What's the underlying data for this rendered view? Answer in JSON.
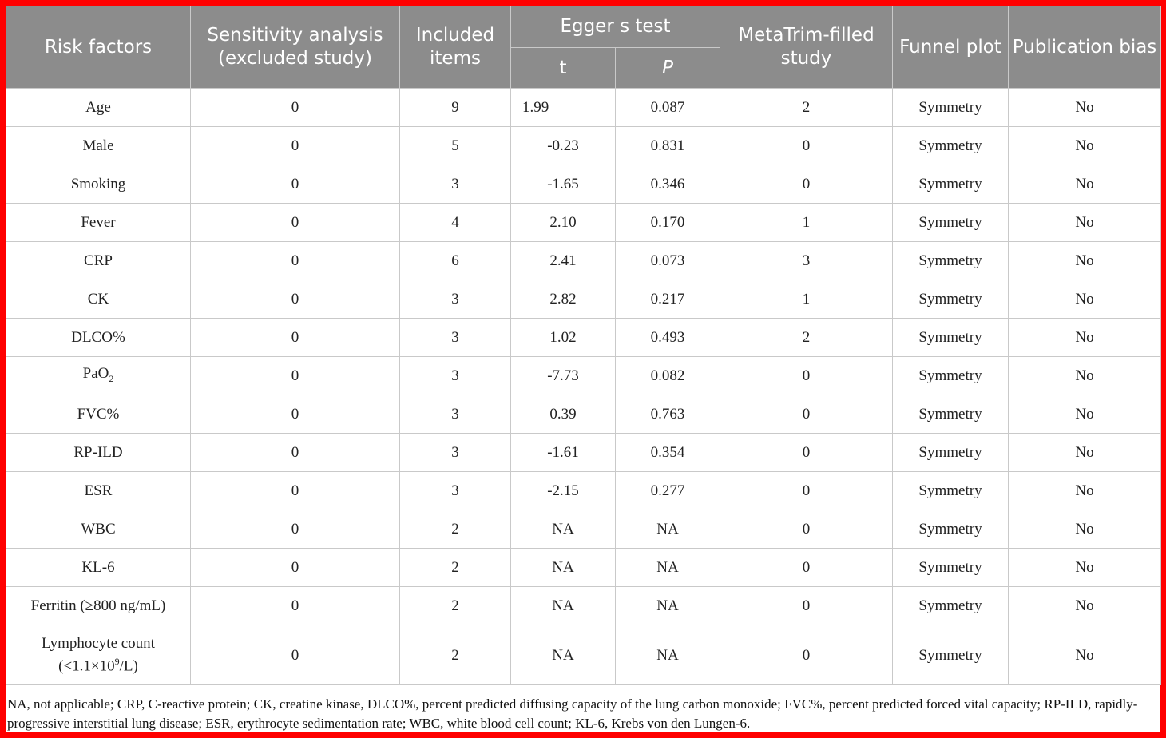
{
  "table": {
    "headers": {
      "risk_factors": "Risk factors",
      "sensitivity": "Sensitivity analysis (excluded study)",
      "included": "Included items",
      "egger": "Egger s test",
      "t": "t",
      "p": "P",
      "metatrim": "MetaTrim-filled study",
      "funnel": "Funnel plot",
      "bias": "Publication bias"
    },
    "rows": [
      {
        "factor": "Age",
        "excluded": "0",
        "included": "9",
        "t": "1.99",
        "p": "0.087",
        "filled": "2",
        "funnel": "Symmetry",
        "bias": "No"
      },
      {
        "factor": "Male",
        "excluded": "0",
        "included": "5",
        "t": "-0.23",
        "p": "0.831",
        "filled": "0",
        "funnel": "Symmetry",
        "bias": "No"
      },
      {
        "factor": "Smoking",
        "excluded": "0",
        "included": "3",
        "t": "-1.65",
        "p": "0.346",
        "filled": "0",
        "funnel": "Symmetry",
        "bias": "No"
      },
      {
        "factor": "Fever",
        "excluded": "0",
        "included": "4",
        "t": "2.10",
        "p": "0.170",
        "filled": "1",
        "funnel": "Symmetry",
        "bias": "No"
      },
      {
        "factor": "CRP",
        "excluded": "0",
        "included": "6",
        "t": "2.41",
        "p": "0.073",
        "filled": "3",
        "funnel": "Symmetry",
        "bias": "No"
      },
      {
        "factor": "CK",
        "excluded": "0",
        "included": "3",
        "t": "2.82",
        "p": "0.217",
        "filled": "1",
        "funnel": "Symmetry",
        "bias": "No"
      },
      {
        "factor": "DLCO%",
        "excluded": "0",
        "included": "3",
        "t": "1.02",
        "p": "0.493",
        "filled": "2",
        "funnel": "Symmetry",
        "bias": "No"
      },
      {
        "factor": "PaO",
        "factor_sub": "2",
        "excluded": "0",
        "included": "3",
        "t": "-7.73",
        "p": "0.082",
        "filled": "0",
        "funnel": "Symmetry",
        "bias": "No"
      },
      {
        "factor": "FVC%",
        "excluded": "0",
        "included": "3",
        "t": "0.39",
        "p": "0.763",
        "filled": "0",
        "funnel": "Symmetry",
        "bias": "No"
      },
      {
        "factor": "RP-ILD",
        "excluded": "0",
        "included": "3",
        "t": "-1.61",
        "p": "0.354",
        "filled": "0",
        "funnel": "Symmetry",
        "bias": "No"
      },
      {
        "factor": "ESR",
        "excluded": "0",
        "included": "3",
        "t": "-2.15",
        "p": "0.277",
        "filled": "0",
        "funnel": "Symmetry",
        "bias": "No"
      },
      {
        "factor": "WBC",
        "excluded": "0",
        "included": "2",
        "t": "NA",
        "p": "NA",
        "filled": "0",
        "funnel": "Symmetry",
        "bias": "No"
      },
      {
        "factor": "KL-6",
        "excluded": "0",
        "included": "2",
        "t": "NA",
        "p": "NA",
        "filled": "0",
        "funnel": "Symmetry",
        "bias": "No"
      },
      {
        "factor": "Ferritin (≥800 ng/mL)",
        "excluded": "0",
        "included": "2",
        "t": "NA",
        "p": "NA",
        "filled": "0",
        "funnel": "Symmetry",
        "bias": "No"
      },
      {
        "factor": "Lymphocyte count",
        "factor_line2_pre": "(<1.1×10",
        "factor_line2_sup": "9",
        "factor_line2_post": "/L)",
        "excluded": "0",
        "included": "2",
        "t": "NA",
        "p": "NA",
        "filled": "0",
        "funnel": "Symmetry",
        "bias": "No"
      }
    ]
  },
  "footnote": "NA, not applicable; CRP, C-reactive protein; CK, creatine kinase, DLCO%, percent predicted diffusing capacity of the lung carbon monoxide; FVC%, percent predicted forced vital capacity; RP-ILD, rapidly-progressive interstitial lung disease; ESR, erythrocyte sedimentation rate; WBC, white blood cell count; KL-6, Krebs von den Lungen-6.",
  "colors": {
    "frame": "#ff0000",
    "header_bg": "#8c8c8c",
    "header_text": "#ffffff",
    "grid": "#c9c9c9"
  }
}
